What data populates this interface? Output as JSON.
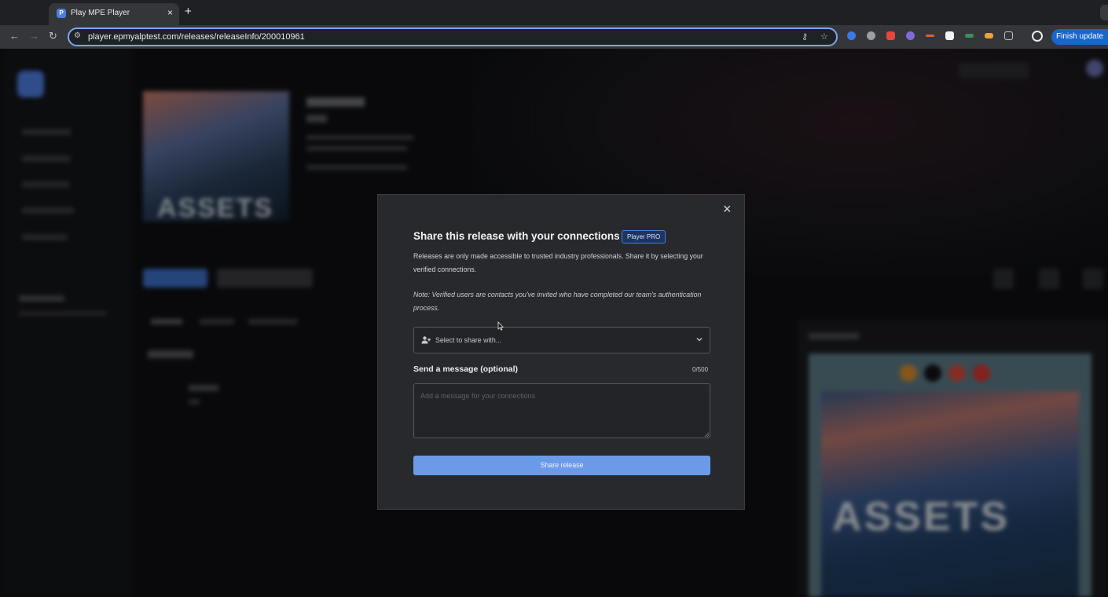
{
  "browser": {
    "tab_title": "Play MPE Player",
    "tab_close": "×",
    "new_tab": "+",
    "url": "player.epmyalptest.com/releases/releaseInfo/200010961",
    "finish_update": "Finish update"
  },
  "background": {
    "cover_text": "ASSETS",
    "promo_cover_text": "ASSETS"
  },
  "modal": {
    "close": "×",
    "title": "Share this release with your connections",
    "badge": "Player PRO",
    "description": "Releases are only made accessible to trusted industry professionals. Share it by selecting your verified connections.",
    "note": "Note: Verified users are contacts you've invited who have completed our team's authentication process.",
    "select_placeholder": "Select to share with...",
    "message_label": "Send a message (optional)",
    "message_count": "0/500",
    "message_placeholder": "Add a message for your connections",
    "share_button": "Share release"
  },
  "colors": {
    "accent": "#6b9be8",
    "modal_bg": "#28292c",
    "badge_border": "#4b7fd8"
  }
}
